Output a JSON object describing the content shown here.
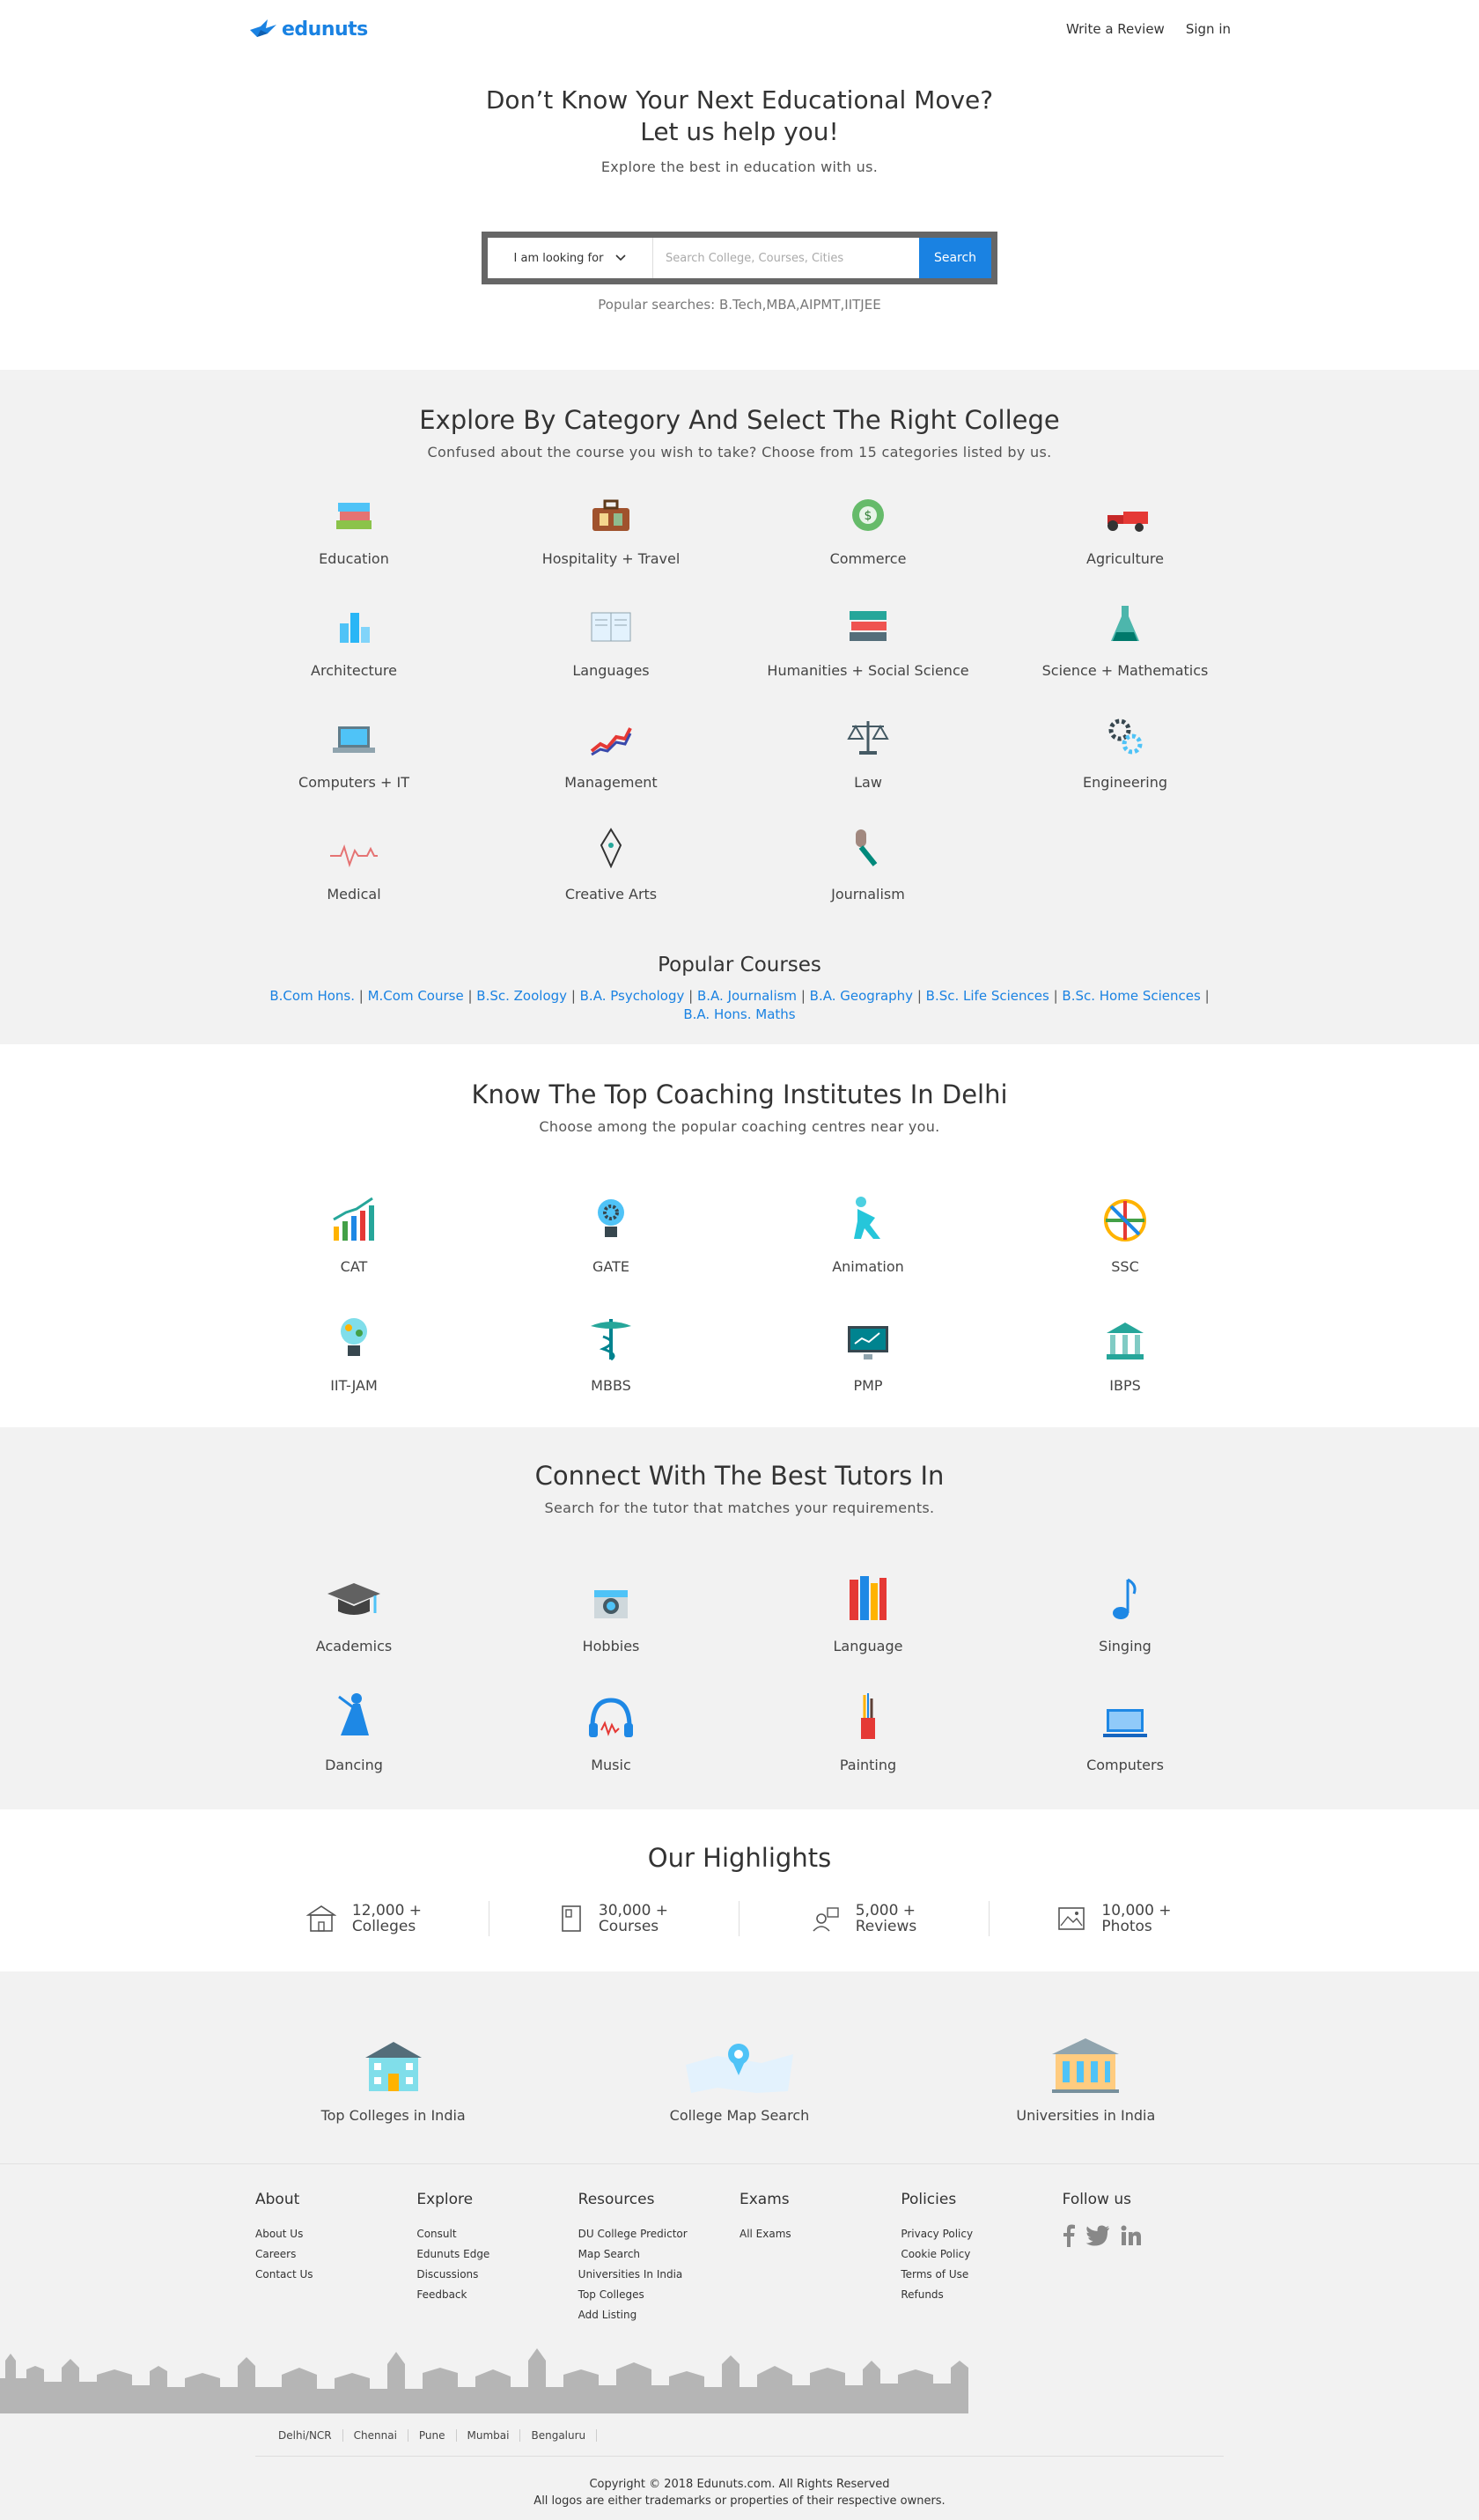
{
  "brand": {
    "name": "edunuts",
    "color": "#1a82e2"
  },
  "nav": {
    "write_review": "Write a Review",
    "sign_in": "Sign in"
  },
  "hero": {
    "title_line1": "Don’t Know Your Next Educational Move?",
    "title_line2": "Let us help you!",
    "subtitle": "Explore the best in education with us.",
    "select_label": "I am looking for",
    "search_placeholder": "Search College, Courses, Cities",
    "search_button": "Search",
    "popular_searches": "Popular searches: B.Tech,MBA,AIPMT,IITJEE"
  },
  "categories": {
    "title": "Explore By Category And Select The Right College",
    "subtitle": "Confused about the course you wish to take? Choose from 15 categories listed by us.",
    "items": [
      {
        "label": "Education",
        "icon": "books-icon"
      },
      {
        "label": "Hospitality + Travel",
        "icon": "suitcase-icon"
      },
      {
        "label": "Commerce",
        "icon": "money-icon"
      },
      {
        "label": "Agriculture",
        "icon": "tractor-icon"
      },
      {
        "label": "Architecture",
        "icon": "buildings-icon"
      },
      {
        "label": "Languages",
        "icon": "open-book-icon"
      },
      {
        "label": "Humanities + Social Science",
        "icon": "book-stack-icon"
      },
      {
        "label": "Science + Mathematics",
        "icon": "flask-icon"
      },
      {
        "label": "Computers + IT",
        "icon": "laptop-icon"
      },
      {
        "label": "Management",
        "icon": "graph-icon"
      },
      {
        "label": "Law",
        "icon": "scales-icon"
      },
      {
        "label": "Engineering",
        "icon": "gears-icon"
      },
      {
        "label": "Medical",
        "icon": "heartbeat-icon"
      },
      {
        "label": "Creative Arts",
        "icon": "pen-nib-icon"
      },
      {
        "label": "Journalism",
        "icon": "microphone-icon"
      }
    ]
  },
  "popular_courses": {
    "title": "Popular Courses",
    "items": [
      "B.Com Hons.",
      "M.Com Course",
      "B.Sc. Zoology",
      "B.A. Psychology",
      "B.A. Journalism",
      "B.A. Geography",
      "B.Sc. Life Sciences",
      "B.Sc. Home Sciences",
      "B.A. Hons. Maths"
    ]
  },
  "coaching": {
    "title": "Know The Top Coaching Institutes In Delhi",
    "subtitle": "Choose among the popular coaching centres near you.",
    "items": [
      {
        "label": "CAT",
        "icon": "bar-chart-icon"
      },
      {
        "label": "GATE",
        "icon": "bulb-gear-icon"
      },
      {
        "label": "Animation",
        "icon": "figure-icon"
      },
      {
        "label": "SSC",
        "icon": "wheel-icon"
      },
      {
        "label": "IIT-JAM",
        "icon": "bulb-icon"
      },
      {
        "label": "MBBS",
        "icon": "caduceus-icon"
      },
      {
        "label": "PMP",
        "icon": "monitor-icon"
      },
      {
        "label": "IBPS",
        "icon": "bank-icon"
      }
    ]
  },
  "tutors": {
    "title": "Connect With The Best Tutors In",
    "subtitle": "Search for the tutor that matches your requirements.",
    "items": [
      {
        "label": "Academics",
        "icon": "grad-cap-icon"
      },
      {
        "label": "Hobbies",
        "icon": "camera-icon"
      },
      {
        "label": "Language",
        "icon": "books-upright-icon"
      },
      {
        "label": "Singing",
        "icon": "music-note-icon"
      },
      {
        "label": "Dancing",
        "icon": "dancer-icon"
      },
      {
        "label": "Music",
        "icon": "headphones-icon"
      },
      {
        "label": "Painting",
        "icon": "brushes-icon"
      },
      {
        "label": "Computers",
        "icon": "computer-icon"
      }
    ]
  },
  "highlights": {
    "title": "Our Highlights",
    "items": [
      {
        "count": "12,000 +",
        "label": "Colleges",
        "icon": "college-icon"
      },
      {
        "count": "30,000 +",
        "label": "Courses",
        "icon": "document-icon"
      },
      {
        "count": "5,000 +",
        "label": "Reviews",
        "icon": "review-icon"
      },
      {
        "count": "10,000 +",
        "label": "Photos",
        "icon": "photo-icon"
      }
    ]
  },
  "quick_links": [
    {
      "label": "Top Colleges in India",
      "icon": "college-building-icon"
    },
    {
      "label": "College Map Search",
      "icon": "map-pin-icon"
    },
    {
      "label": "Universities in India",
      "icon": "university-icon"
    }
  ],
  "footer": {
    "columns": [
      {
        "title": "About",
        "links": [
          "About Us",
          "Careers",
          "Contact Us"
        ]
      },
      {
        "title": "Explore",
        "links": [
          "Consult",
          "Edunuts Edge",
          "Discussions",
          "Feedback"
        ]
      },
      {
        "title": "Resources",
        "links": [
          "DU College Predictor",
          "Map Search",
          "Universities In India",
          "Top Colleges",
          "Add Listing"
        ]
      },
      {
        "title": "Exams",
        "links": [
          "All Exams"
        ]
      },
      {
        "title": "Policies",
        "links": [
          "Privacy Policy",
          "Cookie Policy",
          "Terms of Use",
          "Refunds"
        ]
      }
    ],
    "follow": "Follow us",
    "cities": [
      "Delhi/NCR",
      "Chennai",
      "Pune",
      "Mumbai",
      "Bengaluru"
    ],
    "copyright": "Copyright © 2018 Edunuts.com. All Rights Reserved",
    "trademark": "All logos are either trademarks or properties of their respective owners."
  }
}
